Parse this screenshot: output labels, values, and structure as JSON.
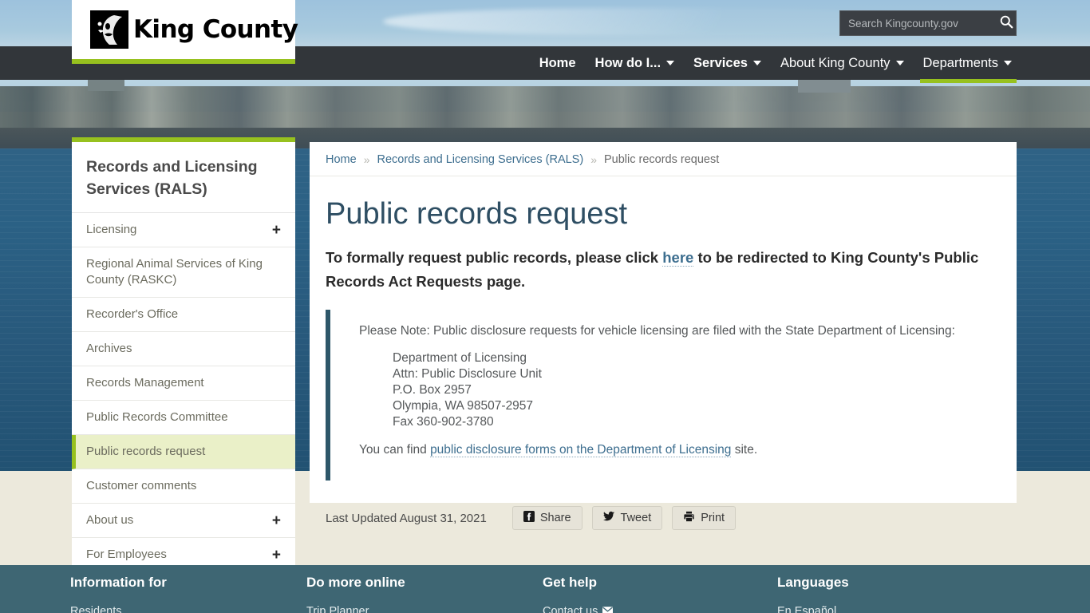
{
  "header": {
    "logo_text": "King County",
    "logo_icon": "king-county-face-logo",
    "search": {
      "placeholder": "Search Kingcounty.gov",
      "value": "",
      "icon": "search-icon"
    },
    "nav": [
      {
        "label": "Home",
        "bold": true,
        "caret": false,
        "active": false
      },
      {
        "label": "How do I...",
        "bold": true,
        "caret": true,
        "active": false
      },
      {
        "label": "Services",
        "bold": true,
        "caret": true,
        "active": false
      },
      {
        "label": "About King County",
        "bold": false,
        "caret": true,
        "active": false
      },
      {
        "label": "Departments",
        "bold": false,
        "caret": true,
        "active": true
      }
    ]
  },
  "sidebar": {
    "title": "Records and Licensing Services (RALS)",
    "items": [
      {
        "label": "Licensing",
        "expandable": true,
        "current": false,
        "expand_icon": "+"
      },
      {
        "label": "Regional Animal Services of King County (RASKC)",
        "expandable": false,
        "current": false
      },
      {
        "label": "Recorder's Office",
        "expandable": false,
        "current": false
      },
      {
        "label": "Archives",
        "expandable": false,
        "current": false
      },
      {
        "label": "Records Management",
        "expandable": false,
        "current": false
      },
      {
        "label": "Public Records Committee",
        "expandable": false,
        "current": false
      },
      {
        "label": "Public records request",
        "expandable": false,
        "current": true
      },
      {
        "label": "Customer comments",
        "expandable": false,
        "current": false
      },
      {
        "label": "About us",
        "expandable": true,
        "current": false,
        "expand_icon": "+"
      },
      {
        "label": "For Employees",
        "expandable": true,
        "current": false,
        "expand_icon": "+"
      }
    ]
  },
  "breadcrumb": {
    "separator": "»",
    "items": [
      {
        "label": "Home",
        "link": true
      },
      {
        "label": "Records and Licensing Services (RALS)",
        "link": true
      },
      {
        "label": "Public records request",
        "link": false
      }
    ]
  },
  "main": {
    "title": "Public records request",
    "lead_before": "To formally request public records, please click ",
    "lead_link": "here",
    "lead_after": " to be redirected to King County's Public Records Act Requests page.",
    "note_intro": "Please Note: Public disclosure requests for vehicle licensing are filed with the State Department of Licensing:",
    "address": [
      "Department of Licensing",
      "Attn: Public Disclosure Unit",
      "P.O. Box 2957",
      "Olympia, WA 98507-2957",
      "Fax 360-902-3780"
    ],
    "find_before": "You can find ",
    "find_link": "public disclosure forms on the Department of Licensing",
    "find_after": " site."
  },
  "meta": {
    "last_updated": "Last Updated August 31, 2021",
    "buttons": [
      {
        "label": "Share",
        "icon": "facebook-icon"
      },
      {
        "label": "Tweet",
        "icon": "twitter-icon"
      },
      {
        "label": "Print",
        "icon": "printer-icon"
      }
    ]
  },
  "footer": {
    "columns": [
      {
        "heading": "Information for",
        "links": [
          {
            "label": "Residents",
            "icon": null
          }
        ]
      },
      {
        "heading": "Do more online",
        "links": [
          {
            "label": "Trip Planner",
            "icon": null
          }
        ]
      },
      {
        "heading": "Get help",
        "links": [
          {
            "label": "Contact us",
            "icon": "envelope-icon"
          }
        ]
      },
      {
        "heading": "Languages",
        "links": [
          {
            "label": "En Español",
            "icon": null
          }
        ]
      }
    ]
  },
  "colors": {
    "accent_green": "#97c11f",
    "nav_dark": "#32363a",
    "page_bg": "#ece9dc",
    "footer_bg": "#3e6673",
    "title_blue": "#2e4e63",
    "link_blue": "#3d6e8f",
    "quote_border": "#2d5769",
    "current_bg": "#eaf0c8"
  }
}
